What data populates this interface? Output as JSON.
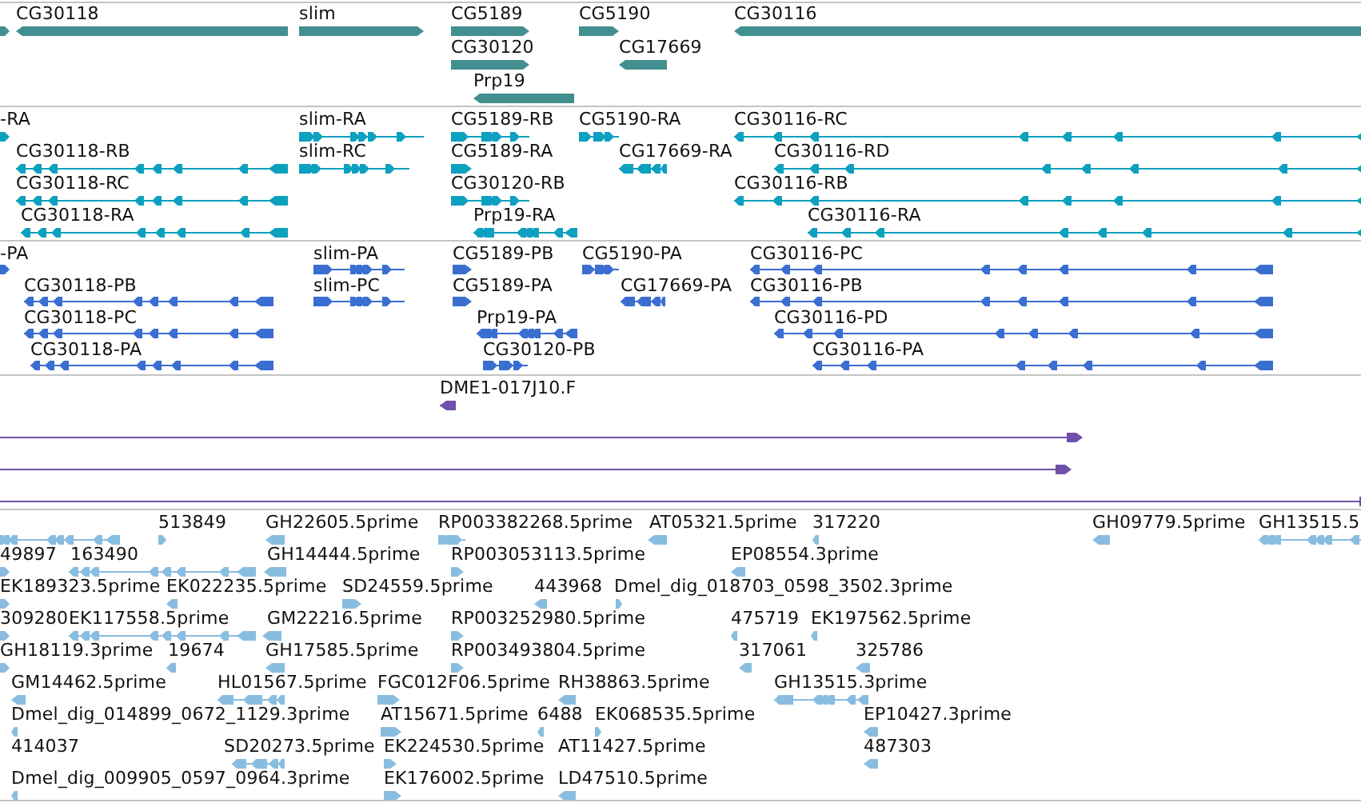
{
  "tracks": [
    {
      "kind": "gene",
      "color": "#428f90",
      "features": [
        {
          "reverse": false
        },
        {
          "label": "CG30118",
          "reverse": true
        },
        {
          "label": "slim",
          "reverse": false
        },
        {
          "label": "CG5189",
          "reverse": false
        },
        {
          "label": "CG5190",
          "reverse": false
        },
        {
          "label": "CG30116",
          "reverse": true
        },
        {
          "label": "CG30120",
          "reverse": false
        },
        {
          "label": "CG17669",
          "reverse": true
        },
        {
          "label": "Prp19",
          "reverse": true
        }
      ]
    },
    {
      "kind": "transcript",
      "color": "#0ea0c0",
      "features": [
        {
          "label": "-RA",
          "reverse": false
        },
        {
          "label": "slim-RA",
          "reverse": false
        },
        {
          "label": "CG5189-RB",
          "reverse": false
        },
        {
          "label": "CG5190-RA",
          "reverse": false
        },
        {
          "label": "CG30116-RC",
          "reverse": true
        },
        {
          "label": "CG30118-RB",
          "reverse": true
        },
        {
          "label": "slim-RC",
          "reverse": false
        },
        {
          "label": "CG5189-RA",
          "reverse": false
        },
        {
          "label": "CG17669-RA",
          "reverse": true
        },
        {
          "label": "CG30116-RD",
          "reverse": true
        },
        {
          "label": "CG30118-RC",
          "reverse": true
        },
        {
          "label": "CG30120-RB",
          "reverse": false
        },
        {
          "label": "CG30116-RB",
          "reverse": true
        },
        {
          "label": "CG30118-RA",
          "reverse": true
        },
        {
          "label": "Prp19-RA",
          "reverse": true
        },
        {
          "label": "CG30116-RA",
          "reverse": true
        }
      ]
    },
    {
      "kind": "transcript",
      "color": "#3a6ed0",
      "features": [
        {
          "label": "-PA",
          "reverse": false
        },
        {
          "label": "slim-PA",
          "reverse": false
        },
        {
          "label": "CG5189-PB",
          "reverse": false
        },
        {
          "label": "CG5190-PA",
          "reverse": false
        },
        {
          "label": "CG30116-PC",
          "reverse": true
        },
        {
          "label": "CG30118-PB",
          "reverse": true
        },
        {
          "label": "slim-PC",
          "reverse": false
        },
        {
          "label": "CG5189-PA",
          "reverse": false
        },
        {
          "label": "CG17669-PA",
          "reverse": true
        },
        {
          "label": "CG30116-PB",
          "reverse": true
        },
        {
          "label": "CG30118-PC",
          "reverse": true
        },
        {
          "label": "Prp19-PA",
          "reverse": true
        },
        {
          "label": "CG30116-PD",
          "reverse": true
        },
        {
          "label": "CG30118-PA",
          "reverse": true
        },
        {
          "label": "CG30120-PB",
          "reverse": false
        },
        {
          "label": "CG30116-PA",
          "reverse": true
        }
      ]
    },
    {
      "kind": "clone",
      "color": "#7050a8",
      "features": [
        {
          "label": "DME1-017J10.F",
          "reverse": true
        },
        {
          "reverse": false
        },
        {
          "reverse": false
        },
        {
          "reverse": false
        }
      ]
    },
    {
      "kind": "est",
      "color": "#88bde0",
      "features": [
        {
          "reverse": true
        },
        {
          "label": "513849",
          "reverse": false
        },
        {
          "label": "GH22605.5prime",
          "reverse": true
        },
        {
          "label": "RP003382268.5prime",
          "reverse": false
        },
        {
          "label": "AT05321.5prime",
          "reverse": true
        },
        {
          "label": "317220",
          "reverse": true
        },
        {
          "label": "GH09779.5prime",
          "reverse": true
        },
        {
          "label": "GH13515.5",
          "reverse": true
        },
        {
          "label": "49897",
          "reverse": false
        },
        {
          "label": "163490",
          "reverse": true
        },
        {
          "label": "GH14444.5prime",
          "reverse": true
        },
        {
          "label": "RP003053113.5prime",
          "reverse": false
        },
        {
          "label": "EP08554.3prime",
          "reverse": true
        },
        {
          "label": "EK189323.5prime",
          "reverse": false
        },
        {
          "label": "EK022235.5prime",
          "reverse": true
        },
        {
          "label": "SD24559.5prime",
          "reverse": false
        },
        {
          "label": "443968",
          "reverse": true
        },
        {
          "label": "Dmel_dig_018703_0598_3502.3prime",
          "reverse": false
        },
        {
          "label": "309280",
          "reverse": false
        },
        {
          "label": "EK117558.5prime",
          "reverse": true
        },
        {
          "label": "GM22216.5prime",
          "reverse": true
        },
        {
          "label": "RP003252980.5prime",
          "reverse": false
        },
        {
          "label": "475719",
          "reverse": true
        },
        {
          "label": "EK197562.5prime",
          "reverse": true
        },
        {
          "label": "GH18119.3prime",
          "reverse": false
        },
        {
          "label": "19674",
          "reverse": true
        },
        {
          "label": "GH17585.5prime",
          "reverse": true
        },
        {
          "label": "RP003493804.5prime",
          "reverse": false
        },
        {
          "label": "317061",
          "reverse": true
        },
        {
          "label": "325786",
          "reverse": true
        },
        {
          "label": "GM14462.5prime",
          "reverse": true
        },
        {
          "label": "HL01567.5prime",
          "reverse": true
        },
        {
          "label": "FGC012F06.5prime",
          "reverse": false
        },
        {
          "label": "RH38863.5prime",
          "reverse": true
        },
        {
          "label": "GH13515.3prime",
          "reverse": true
        },
        {
          "label": "Dmel_dig_014899_0672_1129.3prime",
          "reverse": true
        },
        {
          "label": "AT15671.5prime",
          "reverse": false
        },
        {
          "label": "6488",
          "reverse": true
        },
        {
          "label": "EK068535.5prime",
          "reverse": false
        },
        {
          "label": "EP10427.3prime",
          "reverse": true
        },
        {
          "label": "414037"
        },
        {
          "label": "SD20273.5prime",
          "reverse": true
        },
        {
          "label": "EK224530.5prime",
          "reverse": false
        },
        {
          "label": "AT11427.5prime"
        },
        {
          "label": "487303",
          "reverse": true
        },
        {
          "label": "Dmel_dig_009905_0597_0964.3prime",
          "reverse": true
        },
        {
          "label": "EK176002.5prime",
          "reverse": false
        },
        {
          "label": "LD47510.5prime",
          "reverse": true
        }
      ]
    }
  ]
}
